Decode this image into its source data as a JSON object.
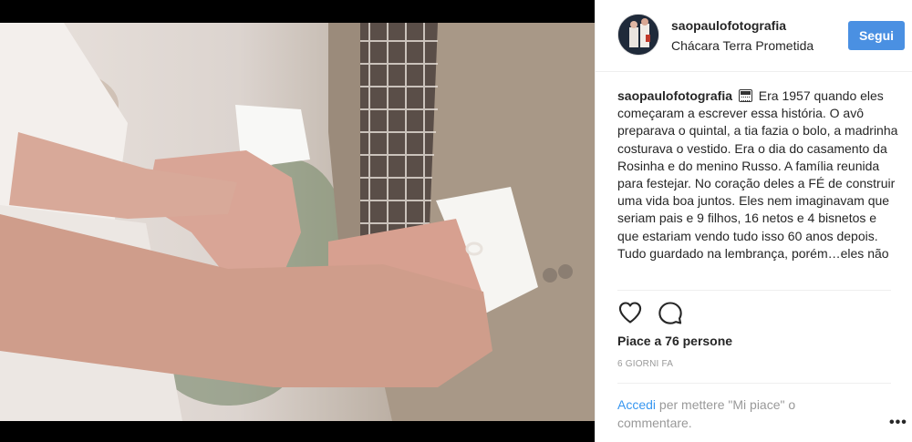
{
  "post": {
    "username": "saopaulofotografia",
    "location": "Chácara Terra Prometida",
    "follow_label": "Segui",
    "caption_username": "saopaulofotografia",
    "caption_text": "Era 1957 quando eles começaram a escrever essa história. O avô preparava o quintal, a tia fazia o bolo, a madrinha costurava o vestido. Era o dia do casamento da Rosinha e do menino Russo. A família reunida para festejar. No coração deles a FÉ de construir uma vida boa juntos. Eles nem imaginavam que seriam pais e 9 filhos, 16 netos e 4 bisnetos e que estariam vendo tudo isso 60 anos depois. Tudo guardado na lembrança, porém…eles não",
    "likes_text": "Piace a 76 persone",
    "date_text": "6 GIORNI FA",
    "login_link": "Accedi",
    "login_rest": " per mettere \"Mi piace\" o commentare.",
    "more_label": "•••"
  },
  "icons": {
    "like": "heart-outline-icon",
    "comment": "speech-bubble-icon",
    "caption_emoji": "calendar-emoji-icon"
  },
  "colors": {
    "follow_button": "#4a90e2",
    "link": "#3897f0",
    "muted_text": "#999999"
  }
}
